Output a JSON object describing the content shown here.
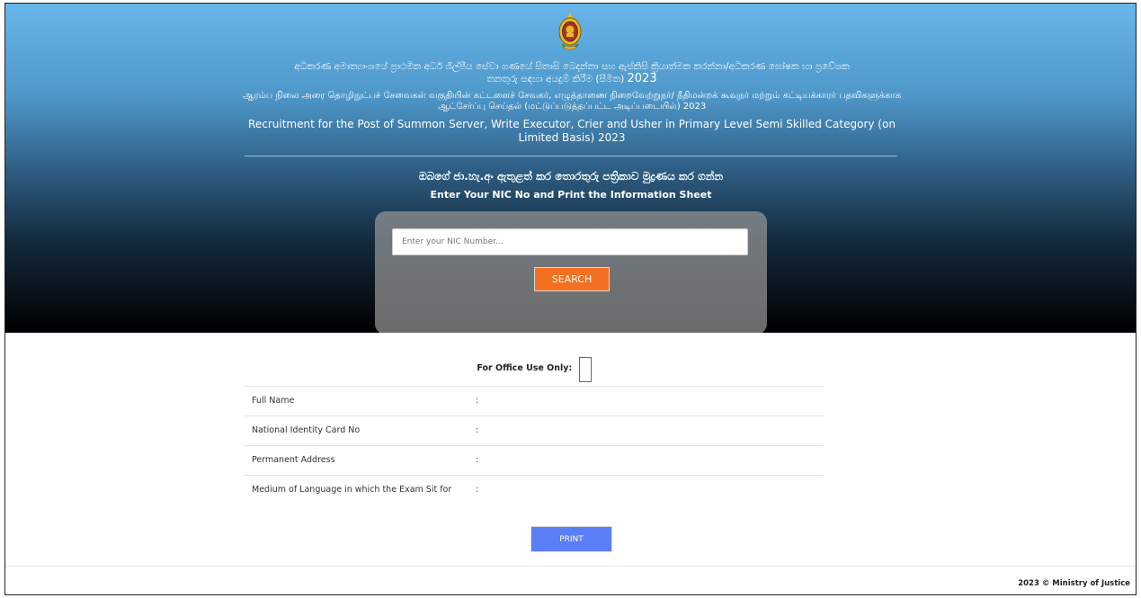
{
  "header": {
    "emblem_icon": "sri-lanka-emblem-icon",
    "title_sinhala_line1": "අධිකරණ අමාත්‍යාංශයේ ප්‍රාථමික අර්ධ ශිල්පීය සේවා ගණයේ සිතාසි බෙදන්නා සහ ඇස්කිසි ක්‍රියාත්මක කරන්නා/අධිකරණ ඝෝෂක හා ප්‍රවේශක",
    "title_sinhala_line2": "තනතුරු සඳහා අයදුම් කිරීම (සීමිත)",
    "title_sinhala_year": "2023",
    "title_tamil": "ஆரம்ப நிலை அரை தொழிநுட்பச் சேவைகள் வகுதியின் கட்டளைச் சேவகர், எழுத்தாணை நிறைவேற்றுநர்/ நீதிமன்றக் கூவுநர் மற்றும் கட்டியக்காரர் பதவிகளுக்காக ஆட்சேர்ப்பு செய்தல் (மட்டுப்படுத்தப்பட்ட அடிப்படையில்) 2023",
    "title_english": "Recruitment for the Post of Summon Server, Write Executor, Crier and Usher in Primary Level Semi Skilled Category (on Limited Basis) 2023",
    "instruction_sinhala": "ඔබගේ ජා.හැ.අං ඇතුළත් කර තොරතුරු පත්‍රිකාව මුද්‍රණය කර ගන්න",
    "instruction_english": "Enter Your NIC No and Print the Information Sheet"
  },
  "search": {
    "placeholder": "Enter your NIC Number...",
    "value": "",
    "button_label": "SEARCH"
  },
  "info_sheet": {
    "office_use_label": "For Office Use Only:",
    "rows": [
      {
        "label": "Full Name",
        "separator": ":"
      },
      {
        "label": "National Identity Card No",
        "separator": ":"
      },
      {
        "label": "Permanent Address",
        "separator": ":"
      },
      {
        "label": "Medium of Language in which the Exam Sit for",
        "separator": ":"
      }
    ],
    "print_label": "PRINT"
  },
  "footer": {
    "copyright": "2023 © Ministry of Justice"
  },
  "colors": {
    "search_button": "#f37021",
    "print_button": "#5b7ef6",
    "hero_top": "#67b6ea",
    "hero_bottom": "#000000"
  }
}
